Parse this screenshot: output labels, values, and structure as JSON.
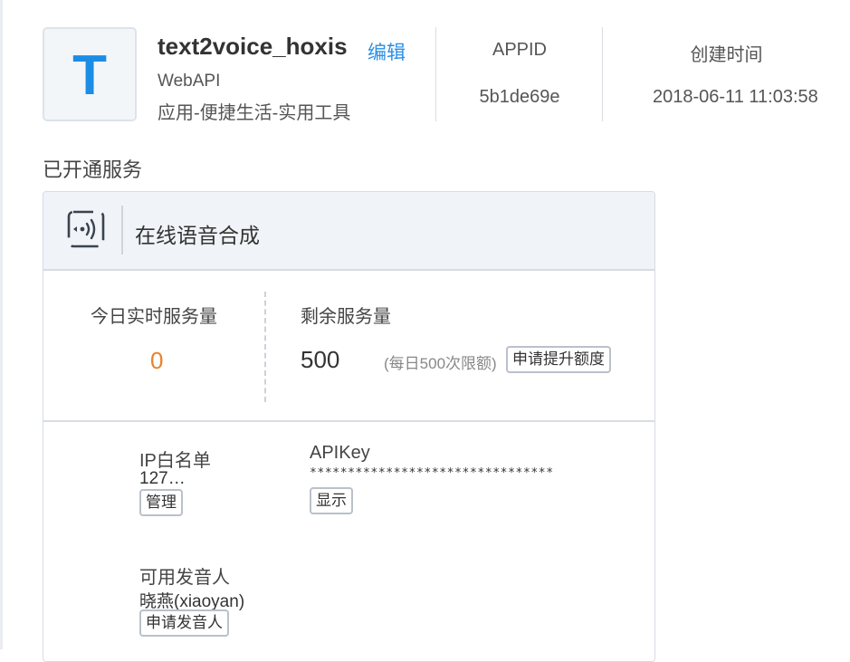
{
  "app": {
    "icon_letter": "T",
    "name": "text2voice_hoxis",
    "edit_label": "编辑",
    "type": "WebAPI",
    "category": "应用-便捷生活-实用工具",
    "appid_label": "APPID",
    "appid_value": "5b1de69e",
    "created_label": "创建时间",
    "created_value": "2018-06-11 11:03:58"
  },
  "services_title": "已开通服务",
  "service": {
    "icon": "speaker-wave-icon",
    "name": "在线语音合成",
    "today_label": "今日实时服务量",
    "today_value": "0",
    "remaining_label": "剩余服务量",
    "remaining_value": "500",
    "limit_note": "(每日500次限额)",
    "raise_button": "申请提升额度",
    "ip_label": "IP白名单",
    "ip_value": "127…",
    "ip_manage_button": "管理",
    "apikey_label": "APIKey",
    "apikey_value": "********************************",
    "apikey_show_button": "显示",
    "voices_label": "可用发音人",
    "voices_value": "晓燕(xiaoyan)",
    "voices_apply_button": "申请发音人"
  },
  "colors": {
    "accent": "#2a8fe4",
    "zero_value": "#e8822d"
  }
}
